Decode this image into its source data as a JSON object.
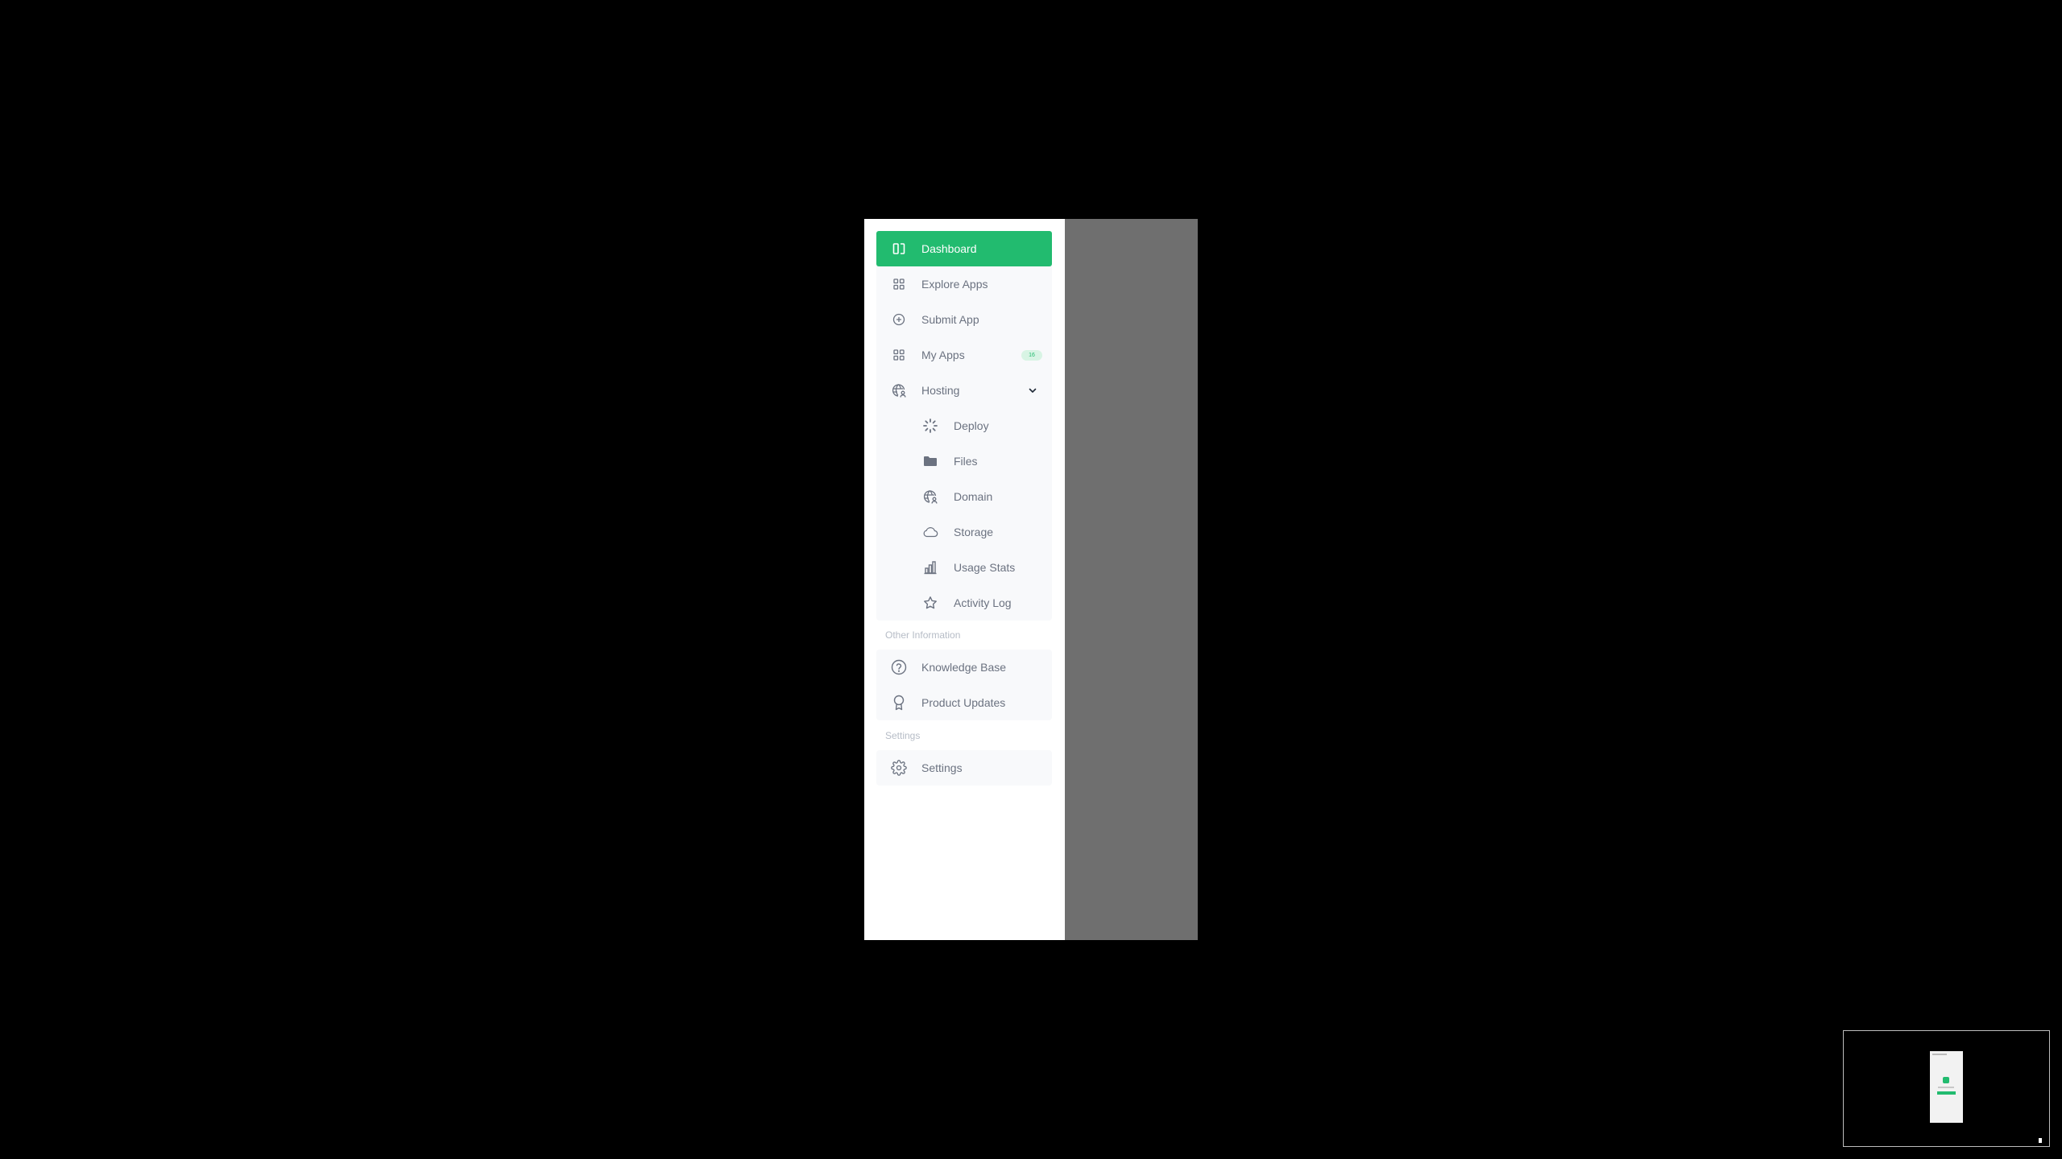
{
  "nav": {
    "main": [
      {
        "label": "Dashboard",
        "icon": "sidebar-panel-icon",
        "active": true
      },
      {
        "label": "Explore Apps",
        "icon": "grid-icon"
      },
      {
        "label": "Submit App",
        "icon": "plus-circle-icon"
      },
      {
        "label": "My Apps",
        "icon": "grid-icon",
        "badge": "16"
      },
      {
        "label": "Hosting",
        "icon": "globe-user-icon",
        "expanded": true
      }
    ],
    "hosting_sub": [
      {
        "label": "Deploy",
        "icon": "loader-icon"
      },
      {
        "label": "Files",
        "icon": "folder-icon"
      },
      {
        "label": "Domain",
        "icon": "globe-user-icon"
      },
      {
        "label": "Storage",
        "icon": "cloud-icon"
      },
      {
        "label": "Usage Stats",
        "icon": "bar-chart-icon"
      },
      {
        "label": "Activity Log",
        "icon": "star-icon"
      }
    ]
  },
  "other_info": {
    "heading": "Other Information",
    "items": [
      {
        "label": "Knowledge Base",
        "icon": "help-circle-icon"
      },
      {
        "label": "Product Updates",
        "icon": "award-icon"
      }
    ]
  },
  "settings_section": {
    "heading": "Settings",
    "items": [
      {
        "label": "Settings",
        "icon": "gear-icon"
      }
    ]
  },
  "colors": {
    "accent": "#22bb6f",
    "text": "#6b7280",
    "group_bg": "#f8f9fb",
    "overlay": "#6f6f6f"
  }
}
